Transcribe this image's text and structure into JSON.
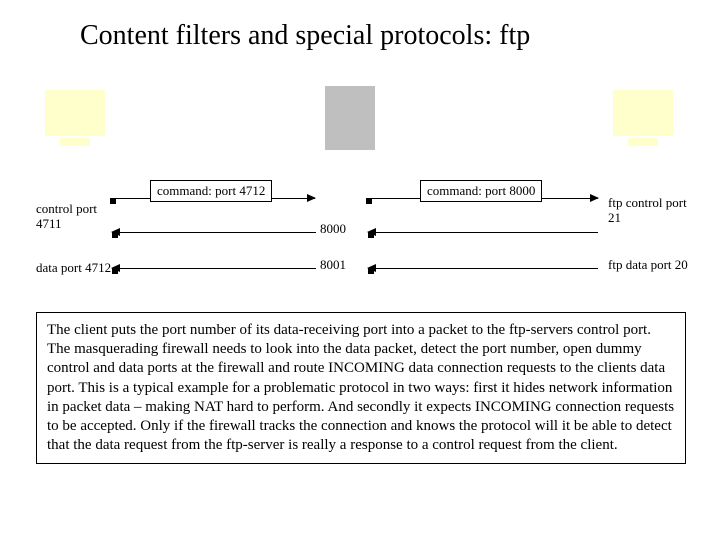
{
  "title": "Content filters and special protocols: ftp",
  "labels": {
    "cmd_left": "command: port 4712",
    "cmd_right": "command: port 8000",
    "control_port_client": "control port 4711",
    "data_port_client": "data port 4712",
    "mid_control": "8000",
    "mid_data": "8001",
    "ftp_control": "ftp control port 21",
    "ftp_data": "ftp data port 20"
  },
  "description": "The client puts the port number of its data-receiving port into a packet to the ftp-servers control port. The masquerading firewall needs to look into the data packet, detect the port number, open dummy control and data ports at the firewall and route INCOMING data connection requests to the clients data port. This is a typical example for a problematic protocol in two ways: first it hides network information in packet data – making NAT hard to perform. And secondly it expects INCOMING connection requests to be accepted. Only if the firewall tracks the connection and knows the protocol will it be able to detect that the data request from the ftp-server is really a response to a control request from the client."
}
